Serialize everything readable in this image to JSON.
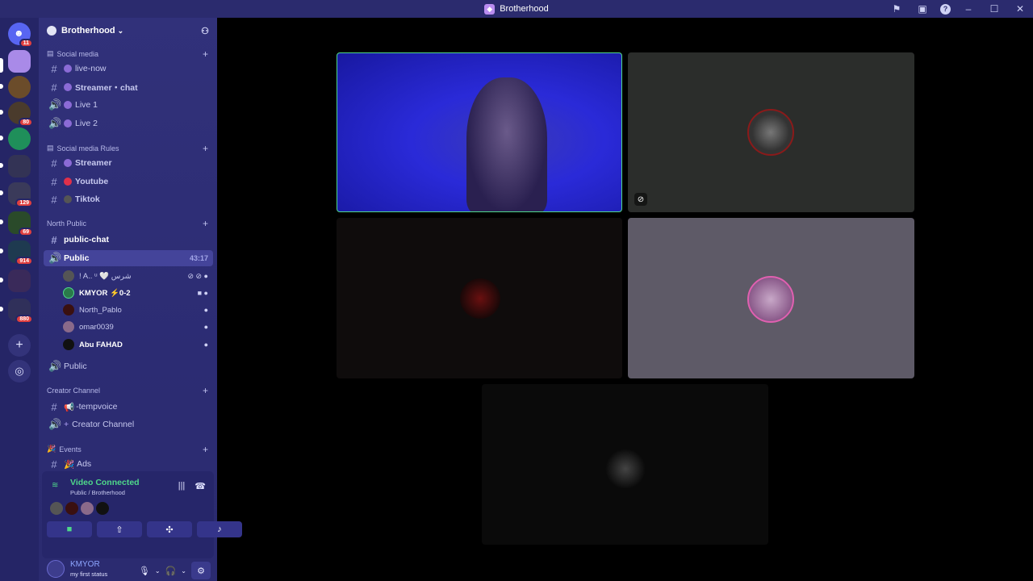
{
  "window": {
    "title": "Brotherhood",
    "controls": [
      "flag-icon",
      "screen-icon",
      "help-icon",
      "minimize-icon",
      "maximize-icon",
      "close-icon"
    ]
  },
  "guilds": [
    {
      "name": "dm-home",
      "badge": "11",
      "color": "#5865f2"
    },
    {
      "name": "brotherhood",
      "badge": "",
      "color": "#a98ae8"
    },
    {
      "name": "server-2",
      "badge": "",
      "color": "#6b4c2a"
    },
    {
      "name": "server-3",
      "badge": "80",
      "color": "#4a3b2c"
    },
    {
      "name": "server-4",
      "badge": "",
      "color": "#1f8f5a"
    },
    {
      "name": "folder-1",
      "badge": "",
      "color": "#333355"
    },
    {
      "name": "folder-2",
      "badge": "129",
      "color": "#3a3a5a"
    },
    {
      "name": "folder-3",
      "badge": "69",
      "color": "#2a4a2a"
    },
    {
      "name": "folder-4",
      "badge": "914",
      "color": "#1e3a50"
    },
    {
      "name": "folder-5",
      "badge": "",
      "color": "#3a2a5a"
    },
    {
      "name": "folder-6",
      "badge": "880",
      "color": "#30305a"
    }
  ],
  "sidebar": {
    "server_name": "Brotherhood",
    "categories": [
      {
        "label": "Social media"
      },
      {
        "label": "Social media Rules"
      },
      {
        "label": "North Public"
      },
      {
        "label": "Creator Channel"
      },
      {
        "label": "Events"
      }
    ],
    "channels": {
      "live_now": "live-now",
      "streamer_chat": "Streamer・chat",
      "live1": "Live 1",
      "live2": "Live 2",
      "streamer": "Streamer",
      "youtube": "Youtube",
      "tiktok": "Tiktok",
      "public_chat": "public-chat",
      "public_voice": "Public",
      "public_timer": "43:17",
      "public2": "Public",
      "tempvoice": "-tempvoice",
      "creator": "Creator Channel",
      "ads": "Ads"
    },
    "voice_users": [
      {
        "name": "! A.. ᵘ 🤍 ﺷﺮﺱ",
        "color": "#555"
      },
      {
        "name": "KMYOR ⚡0-2",
        "color": "#2a7a4a"
      },
      {
        "name": "North_Pablo",
        "color": "#3a1010"
      },
      {
        "name": "omar0039",
        "color": "#8a6a8a"
      },
      {
        "name": "Abu FAHAD",
        "color": "#111"
      }
    ]
  },
  "voice_panel": {
    "status": "Video Connected",
    "location": "Public / Brotherhood"
  },
  "user_panel": {
    "name": "KMYOR",
    "status": "my first status"
  },
  "colors": {
    "accent": "#4fd88a",
    "sidebar": "#2c2c73",
    "tile_dark": "#2b2d2b",
    "tile_grey": "#5e5a67"
  }
}
